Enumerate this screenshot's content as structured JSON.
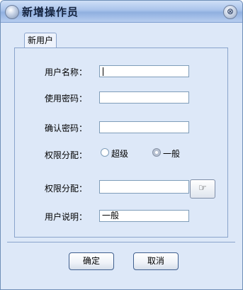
{
  "window": {
    "title": "新增操作员",
    "close_glyph": "⊗"
  },
  "tab": {
    "label": "新用户"
  },
  "form": {
    "username_label": "用户名称：",
    "username_value": "",
    "password_label": "使用密码：",
    "password_value": "",
    "confirm_label": "确认密码：",
    "confirm_value": "",
    "permission_label": "权限分配：",
    "radio_super": "超级",
    "radio_normal": "一般",
    "selected_role": "一般",
    "permission2_label": "权限分配：",
    "permission2_value": "",
    "description_label": "用户说明：",
    "description_value": "一般"
  },
  "buttons": {
    "ok": "确定",
    "cancel": "取消",
    "picker_icon": "hand-pointer-icon",
    "picker_glyph": "☞"
  },
  "colors": {
    "titlebar": "#a9c3ea",
    "panel": "#dde8f8",
    "border": "#8aa4cc"
  }
}
